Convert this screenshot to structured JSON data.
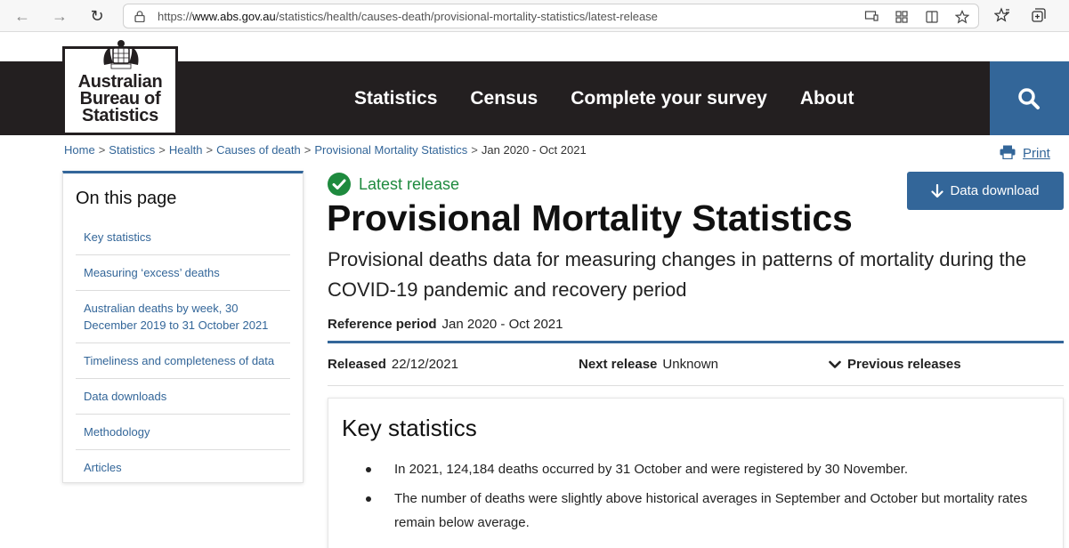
{
  "browser": {
    "url_prefix": "https://",
    "url_domain": "www.abs.gov.au",
    "url_path": "/statistics/health/causes-death/provisional-mortality-statistics/latest-release"
  },
  "logo": {
    "crest_text": "AUSTRALIA",
    "line1": "Australian",
    "line2": "Bureau of",
    "line3": "Statistics"
  },
  "nav": {
    "items": [
      "Statistics",
      "Census",
      "Complete your survey",
      "About"
    ]
  },
  "breadcrumb": {
    "items": [
      "Home",
      "Statistics",
      "Health",
      "Causes of death",
      "Provisional Mortality Statistics"
    ],
    "current": "Jan 2020 - Oct 2021",
    "separator": ">"
  },
  "print": {
    "label": "Print"
  },
  "sidebar": {
    "title": "On this page",
    "items": [
      "Key statistics",
      "Measuring ‘excess’ deaths",
      "Australian deaths by week, 30 December 2019 to 31 October 2021",
      "Timeliness and completeness of data",
      "Data downloads",
      "Methodology",
      "Articles"
    ]
  },
  "main": {
    "badge": "Latest release",
    "title": "Provisional Mortality Statistics",
    "subtitle": "Provisional deaths data for measuring changes in patterns of mortality during the COVID-19 pandemic and recovery period",
    "ref_period_label": "Reference period",
    "ref_period_value": "Jan 2020 - Oct 2021",
    "released_label": "Released",
    "released_value": "22/12/2021",
    "next_release_label": "Next release",
    "next_release_value": "Unknown",
    "previous_releases": "Previous releases",
    "download_label": "Data download"
  },
  "key_statistics": {
    "title": "Key statistics",
    "bullets": [
      "In 2021, 124,184 deaths occurred by 31 October and were registered by 30 November.",
      "The number of deaths were slightly above historical averages in September and October but mortality rates remain below average."
    ]
  },
  "colors": {
    "brand_blue": "#336699",
    "header_dark": "#231f20",
    "success_green": "#1e8a3e"
  }
}
